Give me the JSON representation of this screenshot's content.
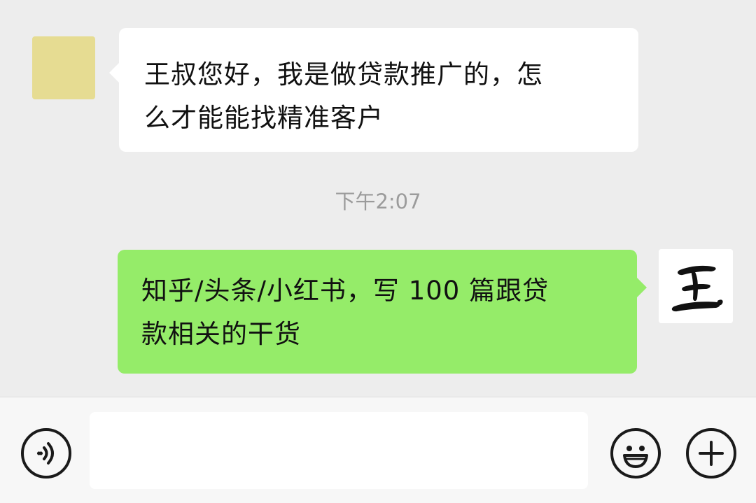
{
  "messages": [
    {
      "direction": "incoming",
      "line1": "王叔您好，我是做贷款推广的，怎",
      "line2": "么才能能找精准客户"
    },
    {
      "direction": "outgoing",
      "line1": "知乎/头条/小红书，写 100 篇跟贷",
      "line2": "款相关的干货"
    }
  ],
  "timestamp": "下午2:07",
  "right_avatar_glyph": "王",
  "input": {
    "value": "",
    "placeholder": ""
  },
  "icons": {
    "voice": "voice-icon",
    "emoji": "emoji-icon",
    "more": "plus-icon"
  },
  "colors": {
    "background": "#ededed",
    "incoming_bubble": "#ffffff",
    "outgoing_bubble": "#95ec69",
    "timestamp_text": "#9b9b9b",
    "left_avatar": "#e6dc92"
  }
}
